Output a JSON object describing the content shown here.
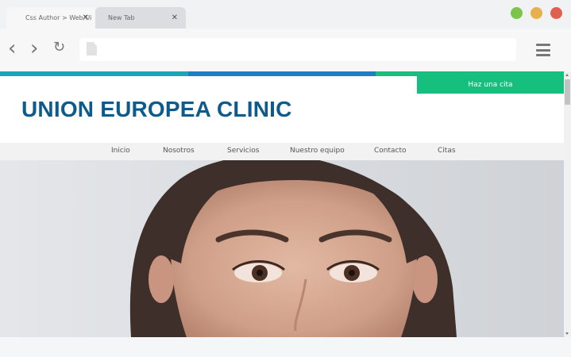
{
  "browser": {
    "tabs": [
      {
        "label": "Css Author > Web/Ui",
        "active": true
      },
      {
        "label": "New Tab",
        "active": false
      }
    ],
    "close_glyph": "✕",
    "window_controls": [
      {
        "name": "minimize",
        "color": "#7cc44a"
      },
      {
        "name": "maximize",
        "color": "#e8b04c"
      },
      {
        "name": "close",
        "color": "#e0604f"
      }
    ],
    "back_glyph": "‹",
    "forward_glyph": "›",
    "reload_glyph": "↻",
    "url": ""
  },
  "site": {
    "brand_stripe_colors": [
      "#1aa6b7",
      "#1f7fc6",
      "#16bf7e"
    ],
    "cta_label": "Haz una cita",
    "title": "UNION EUROPEA CLINIC",
    "nav": [
      "Inicio",
      "Nosotros",
      "Servicios",
      "Nuestro equipo",
      "Contacto",
      "Citas"
    ],
    "hero_image": "woman-face-portrait"
  }
}
